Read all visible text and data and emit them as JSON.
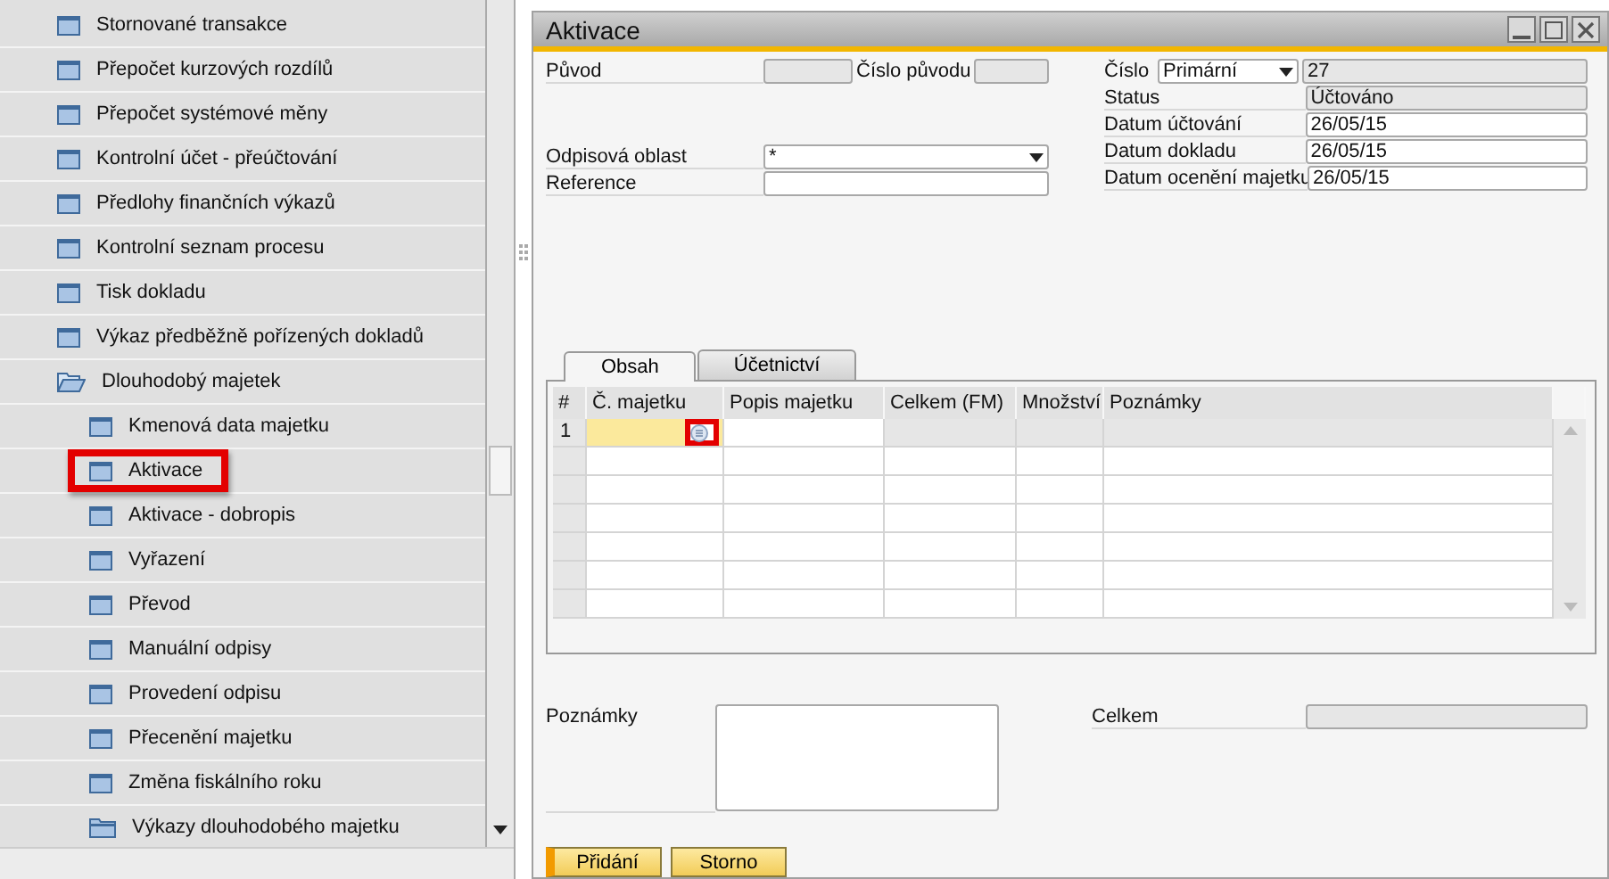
{
  "sidebar": {
    "items": [
      {
        "label": "Stornované transakce",
        "kind": "form",
        "highlighted": false
      },
      {
        "label": "Přepočet kurzových rozdílů",
        "kind": "form",
        "highlighted": false
      },
      {
        "label": "Přepočet systémové měny",
        "kind": "form",
        "highlighted": false
      },
      {
        "label": "Kontrolní účet - přeúčtování",
        "kind": "form",
        "highlighted": false
      },
      {
        "label": "Předlohy finančních výkazů",
        "kind": "form",
        "highlighted": false
      },
      {
        "label": "Kontrolní seznam procesu",
        "kind": "form",
        "highlighted": false
      },
      {
        "label": "Tisk dokladu",
        "kind": "form",
        "highlighted": false
      },
      {
        "label": "Výkaz předběžně pořízených dokladů",
        "kind": "form",
        "highlighted": false
      },
      {
        "label": "Dlouhodobý majetek",
        "kind": "folder",
        "expanded": true,
        "highlighted": false,
        "children": [
          {
            "label": "Kmenová data majetku",
            "kind": "form",
            "highlighted": false
          },
          {
            "label": "Aktivace",
            "kind": "form",
            "highlighted": true
          },
          {
            "label": "Aktivace - dobropis",
            "kind": "form",
            "highlighted": false
          },
          {
            "label": "Vyřazení",
            "kind": "form",
            "highlighted": false
          },
          {
            "label": "Převod",
            "kind": "form",
            "highlighted": false
          },
          {
            "label": "Manuální odpisy",
            "kind": "form",
            "highlighted": false
          },
          {
            "label": "Provedení odpisu",
            "kind": "form",
            "highlighted": false
          },
          {
            "label": "Přecenění majetku",
            "kind": "form",
            "highlighted": false
          },
          {
            "label": "Změna fiskálního roku",
            "kind": "form",
            "highlighted": false
          },
          {
            "label": "Výkazy dlouhodobého majetku",
            "kind": "folder",
            "expanded": false,
            "highlighted": false
          }
        ]
      }
    ]
  },
  "window": {
    "title": "Aktivace",
    "origin": {
      "label": "Původ"
    },
    "origin_number": {
      "label": "Číslo původu"
    },
    "depreciation_area": {
      "label": "Odpisová oblast",
      "value": "*"
    },
    "reference": {
      "label": "Reference"
    },
    "number": {
      "label": "Číslo",
      "series": "Primární",
      "value": "27"
    },
    "right_fields": [
      {
        "label": "Status",
        "value": "Účtováno",
        "kind": "readonly"
      },
      {
        "label": "Datum účtování",
        "value": "26/05/15",
        "kind": "input"
      },
      {
        "label": "Datum dokladu",
        "value": "26/05/15",
        "kind": "input"
      },
      {
        "label": "Datum ocenění majetku",
        "value": "26/05/15",
        "kind": "input"
      }
    ],
    "tabs": [
      {
        "label": "Obsah",
        "selected": true
      },
      {
        "label": "Účetnictví",
        "selected": false
      }
    ],
    "table": {
      "columns": [
        "#",
        "Č. majetku",
        "Popis majetku",
        "Celkem (FM)",
        "Množství",
        "Poznámky"
      ],
      "rows": [
        {
          "number": "1",
          "active": true,
          "link_highlighted": true
        }
      ]
    },
    "remarks": {
      "label": "Poznámky"
    },
    "total": {
      "label": "Celkem"
    },
    "buttons": [
      {
        "label": "Přidání",
        "kind": "primary"
      },
      {
        "label": "Storno",
        "kind": "secondary"
      }
    ]
  }
}
